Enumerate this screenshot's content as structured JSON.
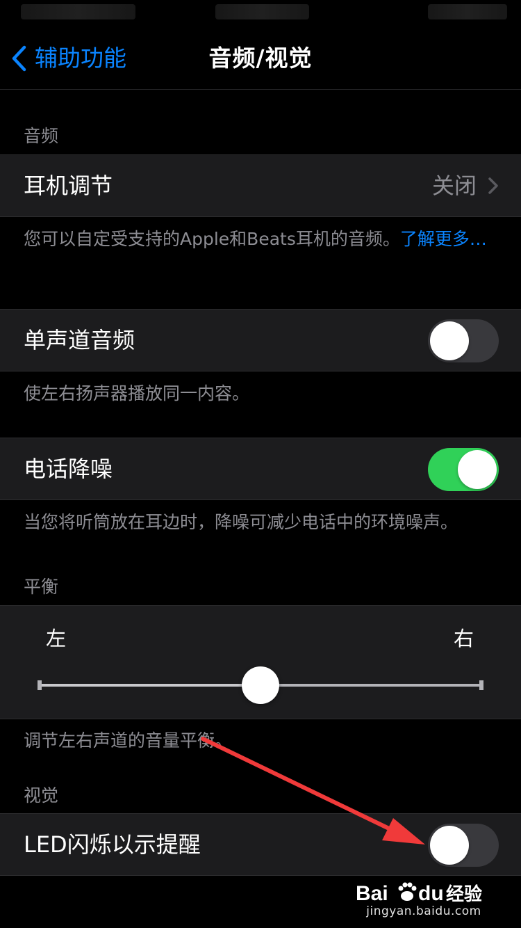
{
  "nav": {
    "back_label": "辅助功能",
    "title": "音频/视觉"
  },
  "audio_section": {
    "header": "音频",
    "headphone": {
      "label": "耳机调节",
      "value": "关闭"
    },
    "headphone_footer": "您可以自定受支持的Apple和Beats耳机的音频。",
    "headphone_footer_link": "了解更多…",
    "mono": {
      "label": "单声道音频",
      "on": false
    },
    "mono_footer": "使左右扬声器播放同一内容。",
    "phone_noise": {
      "label": "电话降噪",
      "on": true
    },
    "phone_noise_footer": "当您将听筒放在耳边时，降噪可减少电话中的环境噪声。"
  },
  "balance_section": {
    "header": "平衡",
    "left_label": "左",
    "right_label": "右",
    "value": 0.5,
    "footer": "调节左右声道的音量平衡。"
  },
  "visual_section": {
    "header": "视觉",
    "led_flash": {
      "label": "LED闪烁以示提醒",
      "on": false
    }
  },
  "watermark": {
    "brand": "Bai du 经验",
    "url": "jingyan.baidu.com"
  },
  "colors": {
    "accent": "#0a84ff",
    "toggle_on": "#30d158",
    "annotation_arrow": "#f03a3a"
  }
}
